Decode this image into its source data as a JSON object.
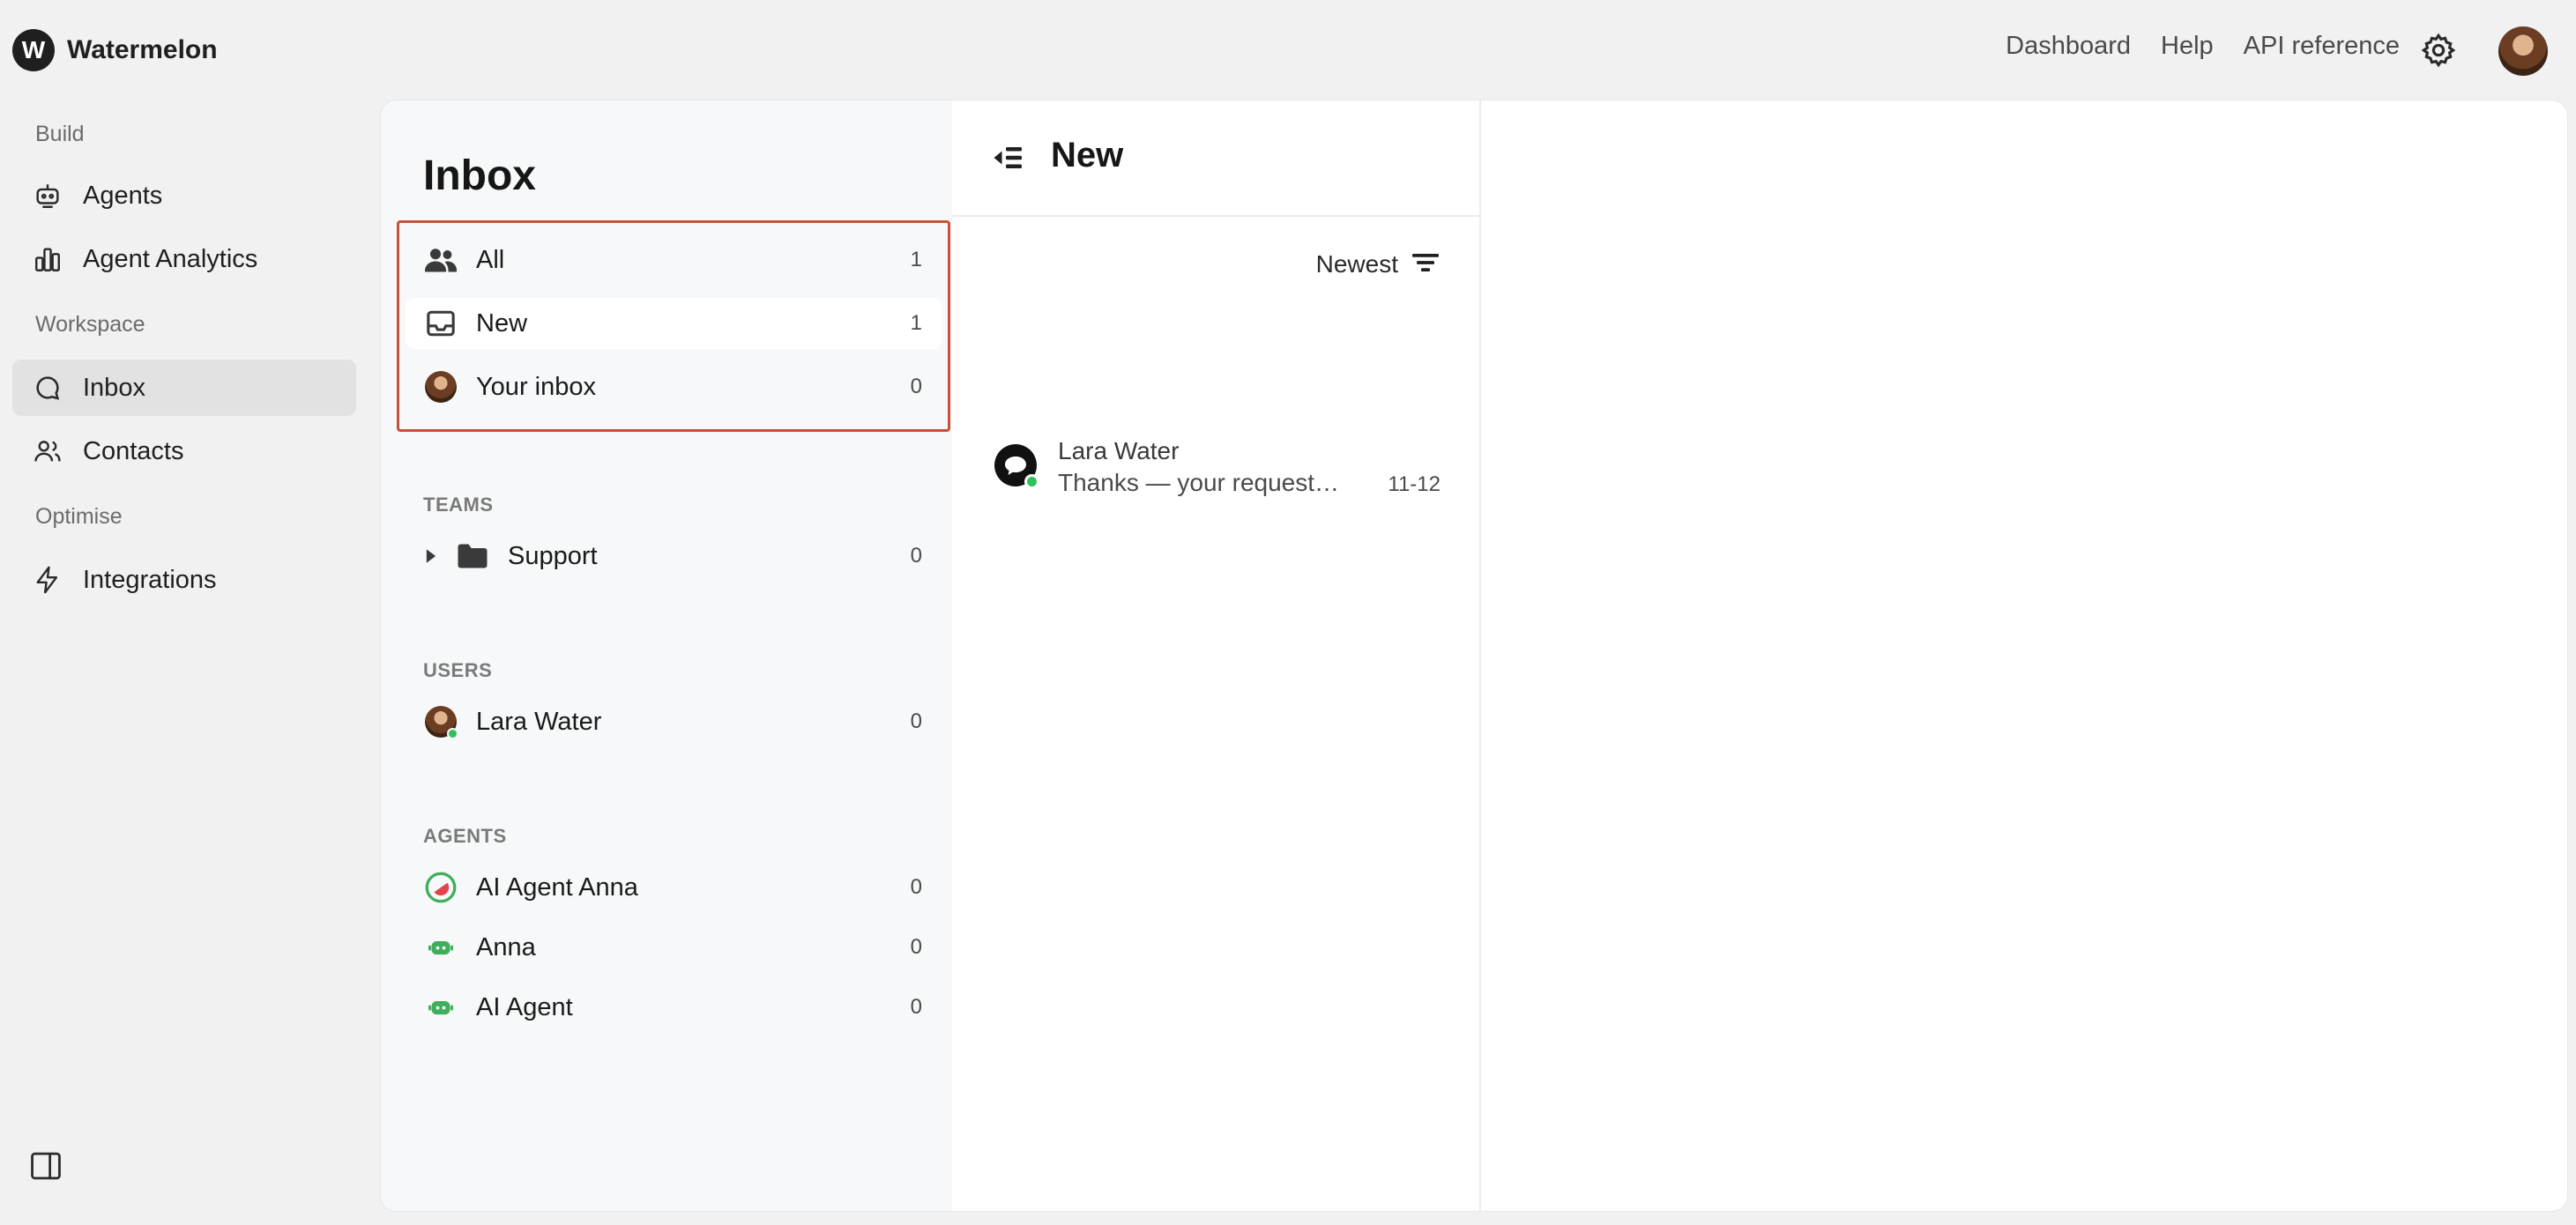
{
  "brand": {
    "logo_letter": "W",
    "name": "Watermelon"
  },
  "top_nav": {
    "items": [
      "Dashboard",
      "Help",
      "API reference"
    ],
    "settings_icon": "gear-icon",
    "avatar": "user-avatar"
  },
  "sidebar": {
    "sections": {
      "build": "Build",
      "workspace": "Workspace",
      "optimise": "Optimise"
    },
    "items": [
      {
        "label": "Agents",
        "icon": "robot-icon"
      },
      {
        "label": "Agent Analytics",
        "icon": "bar-chart-icon"
      },
      {
        "label": "Inbox",
        "icon": "chat-bubble-icon",
        "active": true
      },
      {
        "label": "Contacts",
        "icon": "users-icon"
      },
      {
        "label": "Integrations",
        "icon": "lightning-icon"
      }
    ],
    "toggle_icon": "panel-toggle-icon"
  },
  "inbox": {
    "title": "Inbox",
    "views": [
      {
        "label": "All",
        "count": "1",
        "icon": "people-icon"
      },
      {
        "label": "New",
        "count": "1",
        "icon": "tray-icon",
        "active": true
      },
      {
        "label": "Your inbox",
        "count": "0",
        "icon": "avatar"
      }
    ],
    "teams": {
      "title": "TEAMS",
      "items": [
        {
          "label": "Support",
          "count": "0"
        }
      ]
    },
    "users": {
      "title": "USERS",
      "items": [
        {
          "label": "Lara Water",
          "count": "0"
        }
      ]
    },
    "agents": {
      "title": "AGENTS",
      "items": [
        {
          "label": "AI Agent Anna",
          "count": "0",
          "icon": "watermelon-icon"
        },
        {
          "label": "Anna",
          "count": "0",
          "icon": "bot-icon"
        },
        {
          "label": "AI Agent",
          "count": "0",
          "icon": "bot-icon"
        }
      ]
    }
  },
  "conversation_list": {
    "title": "New",
    "sort_label": "Newest",
    "items": [
      {
        "name": "Lara Water",
        "preview": "Thanks — your request has been received",
        "date": "11-12"
      }
    ]
  },
  "colors": {
    "highlight": "#c9503a",
    "online": "#2ec25a",
    "agent_green": "#3fae5c"
  }
}
